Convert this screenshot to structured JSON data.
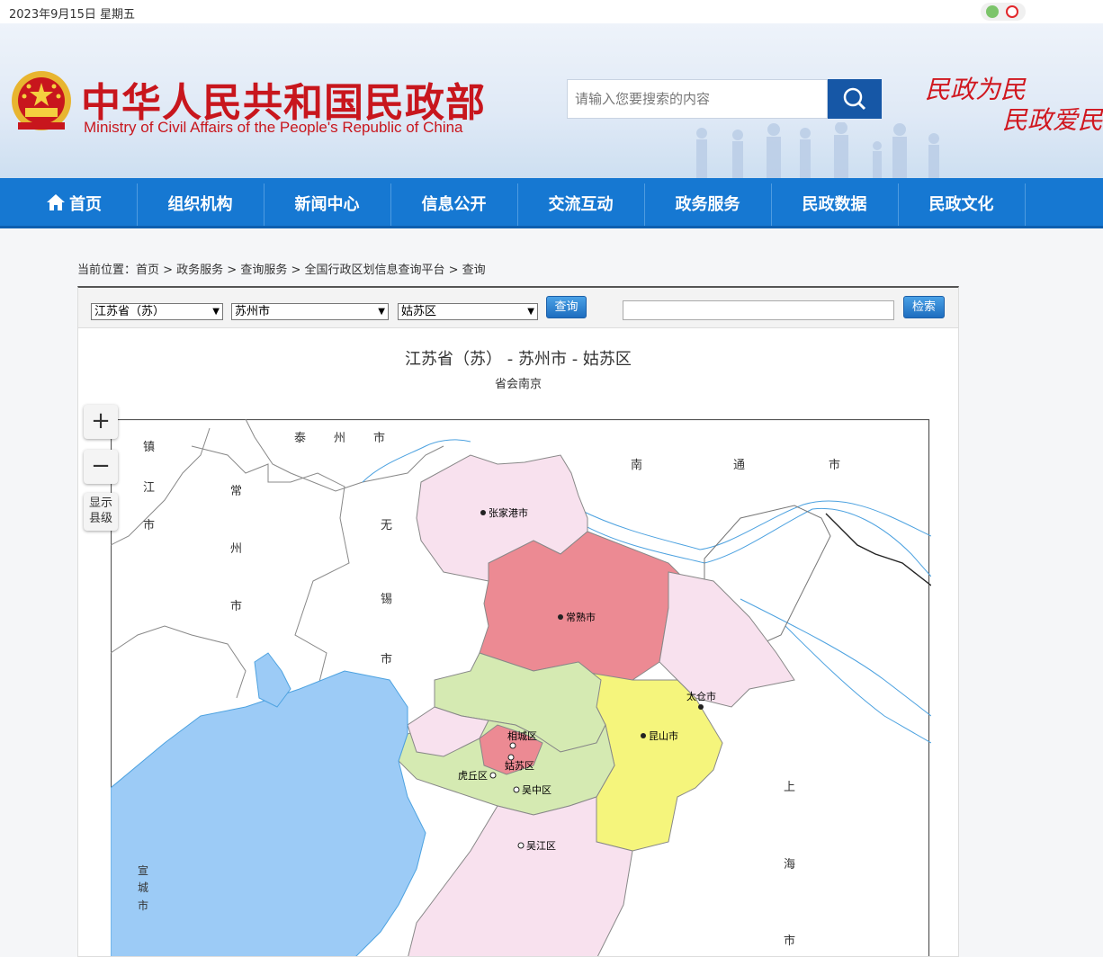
{
  "topbar": {
    "date": "2023年9月15日 星期五",
    "social_icons": [
      "wechat-icon",
      "weibo-icon"
    ]
  },
  "header": {
    "title": "中华人民共和国民政部",
    "subtitle": "Ministry of Civil Affairs of the People's Republic of China",
    "search_placeholder": "请输入您要搜索的内容",
    "slogan_1": "民政为民",
    "slogan_2": "民政爱民",
    "colors": {
      "brand_red": "#c8161d",
      "nav_blue": "#1678d2",
      "search_blue": "#1657a6"
    }
  },
  "nav": {
    "items": [
      {
        "label": "首页",
        "icon": "home-icon"
      },
      {
        "label": "组织机构"
      },
      {
        "label": "新闻中心"
      },
      {
        "label": "信息公开"
      },
      {
        "label": "交流互动"
      },
      {
        "label": "政务服务"
      },
      {
        "label": "民政数据"
      },
      {
        "label": "民政文化"
      }
    ]
  },
  "breadcrumb": "当前位置：首页 > 政务服务 > 查询服务 > 全国行政区划信息查询平台 > 查询",
  "query": {
    "province": "江苏省（苏）",
    "city": "苏州市",
    "district": "姑苏区",
    "query_button": "查询",
    "search_button": "检索",
    "keyword_value": ""
  },
  "map": {
    "title": "江苏省（苏） - 苏州市 - 姑苏区",
    "subtitle": "省会南京",
    "zoom_in": "+",
    "zoom_out": "−",
    "show_county": [
      "显示",
      "县级"
    ],
    "neighbor_labels": {
      "taizhou": [
        "泰",
        "州",
        "市"
      ],
      "zhenjiang": [
        "镇",
        "江",
        "市"
      ],
      "changzhou": [
        "常",
        "州",
        "市"
      ],
      "wuxi": [
        "无",
        "锡",
        "市"
      ],
      "nantong": [
        "南",
        "通",
        "市"
      ],
      "shanghai": [
        "上",
        "海",
        "市"
      ],
      "xuancheng": [
        "宣",
        "城",
        "市"
      ]
    },
    "districts": [
      {
        "name": "张家港市",
        "color": "#f8e1ee"
      },
      {
        "name": "常熟市",
        "color": "#ec8a93"
      },
      {
        "name": "太仓市",
        "color": "#f8e1ee"
      },
      {
        "name": "昆山市",
        "color": "#f5f57c"
      },
      {
        "name": "相城区",
        "color": "#d5eab2"
      },
      {
        "name": "姑苏区",
        "color": "#ec8a93"
      },
      {
        "name": "虎丘区",
        "color": "#f8e1ee"
      },
      {
        "name": "吴中区",
        "color": "#d5eab2"
      },
      {
        "name": "吴江区",
        "color": "#f8e1ee"
      }
    ],
    "colors": {
      "lake": "#9ccbf6",
      "river": "#4da2e0"
    }
  }
}
